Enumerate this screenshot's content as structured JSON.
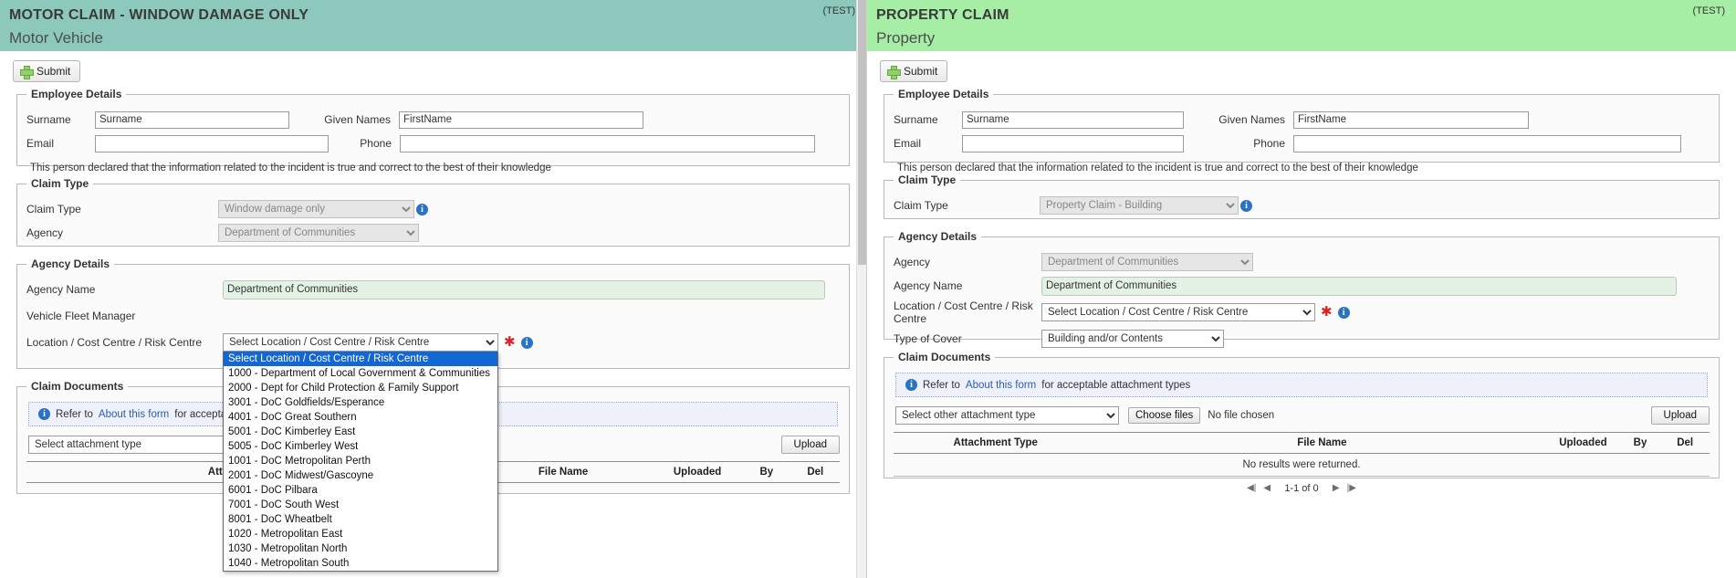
{
  "left": {
    "banner": {
      "title": "MOTOR CLAIM - WINDOW DAMAGE ONLY",
      "subtitle": "Motor Vehicle",
      "test_tag": "(TEST)"
    },
    "submit_label": "Submit",
    "employee": {
      "legend": "Employee Details",
      "surname_label": "Surname",
      "surname_value": "Surname",
      "given_label": "Given Names",
      "given_value": "FirstName",
      "email_label": "Email",
      "email_value": "",
      "phone_label": "Phone",
      "phone_value": "",
      "declaration": "This person declared that the information related to the incident is true and correct to the best of their knowledge"
    },
    "claim_type": {
      "legend": "Claim Type",
      "type_label": "Claim Type",
      "type_value": "Window damage only",
      "agency_label": "Agency",
      "agency_value": "Department of Communities"
    },
    "agency_details": {
      "legend": "Agency Details",
      "agency_name_label": "Agency Name",
      "agency_name_value": "Department of Communities",
      "fleet_manager_label": "Vehicle Fleet Manager",
      "fleet_manager_value": "",
      "location_label": "Location / Cost Centre / Risk Centre",
      "location_value": "Select Location / Cost Centre / Risk Centre"
    },
    "location_options": [
      "Select Location / Cost Centre / Risk Centre",
      "1000 - Department of Local Government & Communities",
      "2000 - Dept for Child Protection & Family Support",
      "3001 - DoC Goldfields/Esperance",
      "4001 - DoC Great Southern",
      "5001 - DoC Kimberley East",
      "5005 - DoC Kimberley West",
      "1001 - DoC Metropolitan Perth",
      "2001 - DoC Midwest/Gascoyne",
      "6001 - DoC Pilbara",
      "7001 - DoC South West",
      "8001 - DoC Wheatbelt",
      "1020 - Metropolitan East",
      "1030 - Metropolitan North",
      "1040 - Metropolitan South"
    ],
    "documents": {
      "legend": "Claim Documents",
      "notice_prefix": "Refer to",
      "notice_link": "About this form",
      "notice_suffix": "for acceptable attachment types",
      "attachment_select_value": "Select attachment type",
      "upload_label": "Upload",
      "headers": [
        "Attachment Type",
        "File Name",
        "Uploaded",
        "By",
        "Del"
      ]
    }
  },
  "right": {
    "banner": {
      "title": "PROPERTY CLAIM",
      "subtitle": "Property",
      "test_tag": "(TEST)"
    },
    "submit_label": "Submit",
    "employee": {
      "legend": "Employee Details",
      "surname_label": "Surname",
      "surname_value": "Surname",
      "given_label": "Given Names",
      "given_value": "FirstName",
      "email_label": "Email",
      "email_value": "",
      "phone_label": "Phone",
      "phone_value": "",
      "declaration": "This person declared that the information related to the incident is true and correct to the best of their knowledge"
    },
    "claim_type": {
      "legend": "Claim Type",
      "type_label": "Claim Type",
      "type_value": "Property Claim - Building"
    },
    "agency_details": {
      "legend": "Agency Details",
      "agency_label": "Agency",
      "agency_value": "Department of Communities",
      "agency_name_label": "Agency Name",
      "agency_name_value": "Department of Communities",
      "location_label": "Location / Cost Centre / Risk Centre",
      "location_value": "Select Location / Cost Centre / Risk Centre",
      "cover_label": "Type of Cover",
      "cover_value": "Building and/or Contents"
    },
    "documents": {
      "legend": "Claim Documents",
      "notice_prefix": "Refer to",
      "notice_link": "About this form",
      "notice_suffix": "for acceptable attachment types",
      "attachment_select_value": "Select other attachment type",
      "choose_files_label": "Choose files",
      "no_file_label": "No file chosen",
      "upload_label": "Upload",
      "headers": [
        "Attachment Type",
        "File Name",
        "Uploaded",
        "By",
        "Del"
      ],
      "empty_message": "No results were returned.",
      "pager_label": "1-1 of 0",
      "pager_first": "◀|",
      "pager_prev": "◀",
      "pager_next": "▶",
      "pager_last": "|▶"
    }
  },
  "colors": {
    "motor_banner": "#8dc8bc",
    "property_banner": "#a6eda6",
    "dropdown_selected": "#1367d2",
    "required_star": "#e02020",
    "info_icon": "#2a72c4",
    "readonly_field": "#e4f2e6"
  }
}
